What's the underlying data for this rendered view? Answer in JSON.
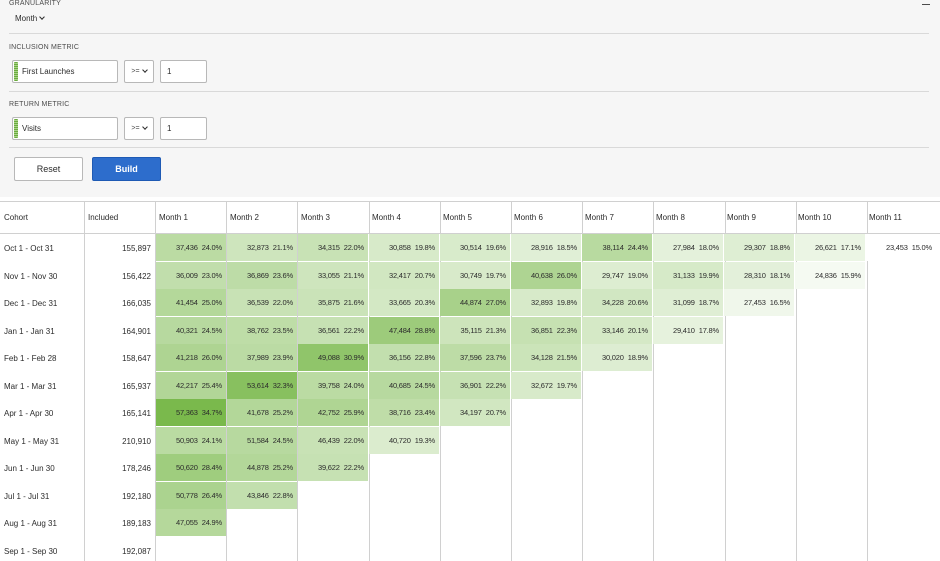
{
  "granularity": {
    "label": "GRANULARITY",
    "value": "Month"
  },
  "inclusion": {
    "label": "INCLUSION METRIC",
    "metric": "First Launches",
    "operator": ">=",
    "value": "1"
  },
  "return": {
    "label": "RETURN METRIC",
    "metric": "Visits",
    "operator": ">=",
    "value": "1"
  },
  "buttons": {
    "reset": "Reset",
    "build": "Build"
  },
  "table": {
    "cohort_header": "Cohort",
    "included_header": "Included",
    "month_headers": [
      "Month 1",
      "Month 2",
      "Month 3",
      "Month 4",
      "Month 5",
      "Month 6",
      "Month 7",
      "Month 8",
      "Month 9",
      "Month 10",
      "Month 11"
    ],
    "rows": [
      {
        "cohort": "Oct 1 - Oct 31",
        "included": "155,897",
        "cells": [
          [
            "37,436",
            "24.0%"
          ],
          [
            "32,873",
            "21.1%"
          ],
          [
            "34,315",
            "22.0%"
          ],
          [
            "30,858",
            "19.8%"
          ],
          [
            "30,514",
            "19.6%"
          ],
          [
            "28,916",
            "18.5%"
          ],
          [
            "38,114",
            "24.4%"
          ],
          [
            "27,984",
            "18.0%"
          ],
          [
            "29,307",
            "18.8%"
          ],
          [
            "26,621",
            "17.1%"
          ],
          [
            "23,453",
            "15.0%"
          ]
        ]
      },
      {
        "cohort": "Nov 1 - Nov 30",
        "included": "156,422",
        "cells": [
          [
            "36,009",
            "23.0%"
          ],
          [
            "36,869",
            "23.6%"
          ],
          [
            "33,055",
            "21.1%"
          ],
          [
            "32,417",
            "20.7%"
          ],
          [
            "30,749",
            "19.7%"
          ],
          [
            "40,638",
            "26.0%"
          ],
          [
            "29,747",
            "19.0%"
          ],
          [
            "31,133",
            "19.9%"
          ],
          [
            "28,310",
            "18.1%"
          ],
          [
            "24,836",
            "15.9%"
          ]
        ]
      },
      {
        "cohort": "Dec 1 - Dec 31",
        "included": "166,035",
        "cells": [
          [
            "41,454",
            "25.0%"
          ],
          [
            "36,539",
            "22.0%"
          ],
          [
            "35,875",
            "21.6%"
          ],
          [
            "33,665",
            "20.3%"
          ],
          [
            "44,874",
            "27.0%"
          ],
          [
            "32,893",
            "19.8%"
          ],
          [
            "34,228",
            "20.6%"
          ],
          [
            "31,099",
            "18.7%"
          ],
          [
            "27,453",
            "16.5%"
          ]
        ]
      },
      {
        "cohort": "Jan 1 - Jan 31",
        "included": "164,901",
        "cells": [
          [
            "40,321",
            "24.5%"
          ],
          [
            "38,762",
            "23.5%"
          ],
          [
            "36,561",
            "22.2%"
          ],
          [
            "47,484",
            "28.8%"
          ],
          [
            "35,115",
            "21.3%"
          ],
          [
            "36,851",
            "22.3%"
          ],
          [
            "33,146",
            "20.1%"
          ],
          [
            "29,410",
            "17.8%"
          ]
        ]
      },
      {
        "cohort": "Feb 1 - Feb 28",
        "included": "158,647",
        "cells": [
          [
            "41,218",
            "26.0%"
          ],
          [
            "37,989",
            "23.9%"
          ],
          [
            "49,088",
            "30.9%"
          ],
          [
            "36,156",
            "22.8%"
          ],
          [
            "37,596",
            "23.7%"
          ],
          [
            "34,128",
            "21.5%"
          ],
          [
            "30,020",
            "18.9%"
          ]
        ]
      },
      {
        "cohort": "Mar 1 - Mar 31",
        "included": "165,937",
        "cells": [
          [
            "42,217",
            "25.4%"
          ],
          [
            "53,614",
            "32.3%"
          ],
          [
            "39,758",
            "24.0%"
          ],
          [
            "40,685",
            "24.5%"
          ],
          [
            "36,901",
            "22.2%"
          ],
          [
            "32,672",
            "19.7%"
          ]
        ]
      },
      {
        "cohort": "Apr 1 - Apr 30",
        "included": "165,141",
        "cells": [
          [
            "57,363",
            "34.7%"
          ],
          [
            "41,678",
            "25.2%"
          ],
          [
            "42,752",
            "25.9%"
          ],
          [
            "38,716",
            "23.4%"
          ],
          [
            "34,197",
            "20.7%"
          ]
        ]
      },
      {
        "cohort": "May 1 - May 31",
        "included": "210,910",
        "cells": [
          [
            "50,903",
            "24.1%"
          ],
          [
            "51,584",
            "24.5%"
          ],
          [
            "46,439",
            "22.0%"
          ],
          [
            "40,720",
            "19.3%"
          ]
        ]
      },
      {
        "cohort": "Jun 1 - Jun 30",
        "included": "178,246",
        "cells": [
          [
            "50,620",
            "28.4%"
          ],
          [
            "44,878",
            "25.2%"
          ],
          [
            "39,622",
            "22.2%"
          ]
        ]
      },
      {
        "cohort": "Jul 1 - Jul 31",
        "included": "192,180",
        "cells": [
          [
            "50,778",
            "26.4%"
          ],
          [
            "43,846",
            "22.8%"
          ]
        ]
      },
      {
        "cohort": "Aug 1 - Aug 31",
        "included": "189,183",
        "cells": [
          [
            "47,055",
            "24.9%"
          ]
        ]
      },
      {
        "cohort": "Sep 1 - Sep 30",
        "included": "192,087",
        "cells": []
      }
    ]
  },
  "colors": {
    "heat_low": "#ffffff",
    "heat_high": "#7ab94c",
    "accent": "#2d6dcc"
  }
}
